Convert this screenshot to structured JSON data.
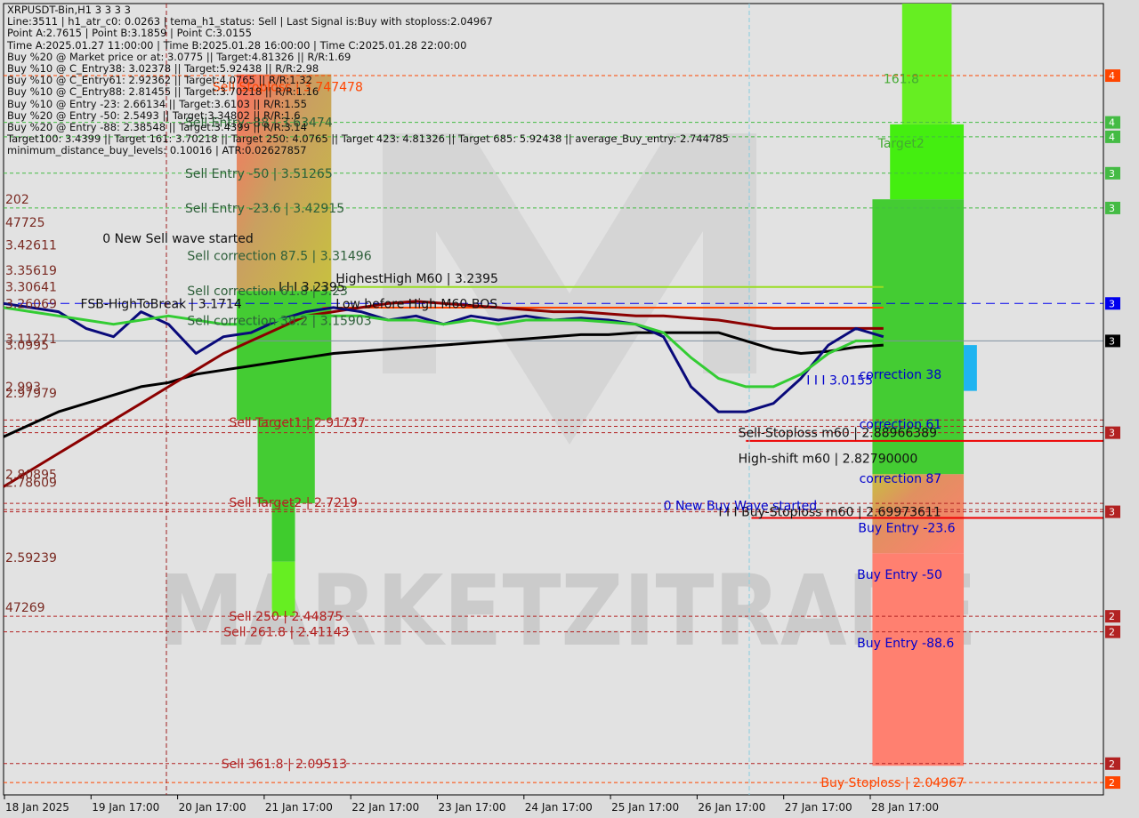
{
  "header": {
    "symbol": "XRPUSDT-Bin,H1  3 3 3 3",
    "lines": [
      "Line:3511 | h1_atr_c0: 0.0263 | tema_h1_status: Sell | Last Signal is:Buy with stoploss:2.04967",
      "Point A:2.7615 | Point B:3.1859 | Point C:3.0155",
      "Time A:2025.01.27 11:00:00 | Time B:2025.01.28 16:00:00 | Time C:2025.01.28 22:00:00",
      "Buy %20 @ Market price or at: 3.0775 || Target:4.81326 || R/R:1.69",
      "Buy %10 @ C_Entry38: 3.02378 || Target:5.92438 || R/R:2.98",
      "Buy %10 @ C_Entry61: 2.92362 || Target:4.0765 || R/R:1.32",
      "Buy %10 @ C_Entry88: 2.81455 || Target:3.70218 || R/R:1.16",
      "Buy %10 @ Entry -23: 2.66134 || Target:3.6103 || R/R:1.55",
      "Buy %20 @ Entry -50: 2.5493 || Target:3.34802 || R/R:1.6",
      "Buy %20 @ Entry -88: 2.38548 || Target:3.4399 || R/R:3.14",
      "Target100: 3.4399 || Target 161: 3.70218 || Target 250: 4.0765 || Target 423: 4.81326 || Target 685: 5.92438 || average_Buy_entry: 2.744785",
      "minimum_distance_buy_levels: 0.10016 | ATR:0.02627857"
    ]
  },
  "watermark": "MARKETZITRADE",
  "colors": {
    "sell_line": "#b22222",
    "buy_line": "#2db82d",
    "stoploss": "#ff4500",
    "ema_black": "#000000",
    "ema_maroon": "#8b0000",
    "tema_navy": "#0a0a7a",
    "green_line": "#33cc33",
    "zone_green": "#44cc33",
    "zone_lime": "#66ee22",
    "zone_red": "#ff8070",
    "zone_olive": "#c8c040",
    "cloud_blue": "#1eb4f0",
    "cloud_orange": "#ff4500"
  },
  "chart_data": {
    "type": "line",
    "title": "XRPUSDT-Bin,H1",
    "xlabel": "",
    "ylabel": "",
    "x_ticks": [
      "18 Jan 2025",
      "19 Jan 17:00",
      "20 Jan 17:00",
      "21 Jan 17:00",
      "22 Jan 17:00",
      "23 Jan 17:00",
      "24 Jan 17:00",
      "25 Jan 17:00",
      "26 Jan 17:00",
      "27 Jan 17:00",
      "28 Jan 17:00"
    ],
    "ylim": [
      2.02,
      3.92
    ],
    "price_badges": [
      {
        "text": "4",
        "price": 3.747,
        "color": "#ff4500"
      },
      {
        "text": "4",
        "price": 3.63474,
        "color": "#44bb44"
      },
      {
        "text": "4",
        "price": 3.6,
        "color": "#44bb44"
      },
      {
        "text": "3",
        "price": 3.51265,
        "color": "#44bb44"
      },
      {
        "text": "3",
        "price": 3.42915,
        "color": "#44bb44"
      },
      {
        "text": "3",
        "price": 3.2,
        "color": "#0000ee"
      },
      {
        "text": "3",
        "price": 3.11,
        "color": "#000000"
      },
      {
        "text": "3",
        "price": 2.88966,
        "color": "#b22222"
      },
      {
        "text": "3",
        "price": 2.69973,
        "color": "#b22222"
      },
      {
        "text": "2",
        "price": 2.44875,
        "color": "#b22222"
      },
      {
        "text": "2",
        "price": 2.41143,
        "color": "#b22222"
      },
      {
        "text": "2",
        "price": 2.09513,
        "color": "#b22222"
      },
      {
        "text": "2",
        "price": 2.04967,
        "color": "#ff4500"
      }
    ],
    "level_labels": [
      {
        "text": "Sell Stoploss | 3.747478",
        "price": 3.72,
        "color": "#ff4500",
        "x": 0.19
      },
      {
        "text": "Sell Entry -88 | 3.63474",
        "price": 3.63474,
        "color": "#2e5f3a",
        "x": 0.165
      },
      {
        "text": "Sell Entry -50 | 3.51265",
        "price": 3.51265,
        "color": "#2e5f3a",
        "x": 0.165
      },
      {
        "text": "Sell Entry -23.6 | 3.42915",
        "price": 3.42915,
        "color": "#2e5f3a",
        "x": 0.165
      },
      {
        "text": "Sell correction 87.5 | 3.31496",
        "price": 3.31496,
        "color": "#2e5f3a",
        "x": 0.167
      },
      {
        "text": "Sell correction 61.8 | 3.23",
        "price": 3.23,
        "color": "#2e5f3a",
        "x": 0.167
      },
      {
        "text": "Sell correction 38.2 | 3.15903",
        "price": 3.15903,
        "color": "#2e5f3a",
        "x": 0.167
      },
      {
        "text": "HighestHigh   M60 | 3.2395",
        "price": 3.26,
        "color": "#111111",
        "x": 0.302
      },
      {
        "text": "Low before High   M60-BOS",
        "price": 3.2,
        "color": "#111111",
        "x": 0.302
      },
      {
        "text": "I I I 3.2395",
        "price": 3.24,
        "color": "#111111",
        "x": 0.25
      },
      {
        "text": "0 New Sell wave started",
        "price": 3.35619,
        "color": "#111111",
        "x": 0.09
      },
      {
        "text": "FSB-HighToBreak | 3.1714",
        "price": 3.2,
        "color": "#111111",
        "x": 0.07
      },
      {
        "text": "Sell Target1 | 2.91737",
        "price": 2.915,
        "color": "#b22222",
        "x": 0.205
      },
      {
        "text": "Sell Target2 | 2.7219",
        "price": 2.7219,
        "color": "#b22222",
        "x": 0.205
      },
      {
        "text": "Sell  250 | 2.44875",
        "price": 2.44875,
        "color": "#b22222",
        "x": 0.205
      },
      {
        "text": "Sell  261.8 | 2.41143",
        "price": 2.41143,
        "color": "#b22222",
        "x": 0.2
      },
      {
        "text": "Sell  361.8 | 2.09513",
        "price": 2.09513,
        "color": "#b22222",
        "x": 0.198
      },
      {
        "text": "I I I 3.0155",
        "price": 3.0155,
        "color": "#0000cc",
        "x": 0.73
      },
      {
        "text": "correction 38",
        "price": 3.03,
        "color": "#0000cc",
        "x": 0.778
      },
      {
        "text": "correction 61",
        "price": 2.91,
        "color": "#0000cc",
        "x": 0.778
      },
      {
        "text": "correction 87",
        "price": 2.78,
        "color": "#0000cc",
        "x": 0.778
      },
      {
        "text": "Sell-Stoploss m60 | 2.88966389",
        "price": 2.89,
        "color": "#111111",
        "x": 0.668
      },
      {
        "text": "High-shift m60 | 2.82790000",
        "price": 2.8279,
        "color": "#111111",
        "x": 0.668
      },
      {
        "text": "I I I Buy-Stoploss m60 | 2.69973611",
        "price": 2.7,
        "color": "#111111",
        "x": 0.65
      },
      {
        "text": "0 New Buy Wave started",
        "price": 2.715,
        "color": "#0000cc",
        "x": 0.6
      },
      {
        "text": "161.8",
        "price": 3.74,
        "color": "#44aa33",
        "x": 0.8
      },
      {
        "text": "Target2",
        "price": 3.585,
        "color": "#44aa33",
        "x": 0.795
      },
      {
        "text": "Buy Entry -23.6",
        "price": 2.66134,
        "color": "#0000cc",
        "x": 0.777
      },
      {
        "text": "Buy Entry -50",
        "price": 2.5493,
        "color": "#0000cc",
        "x": 0.776
      },
      {
        "text": "Buy Entry -88.6",
        "price": 2.38548,
        "color": "#0000cc",
        "x": 0.776
      },
      {
        "text": "Buy Stoploss | 2.04967",
        "price": 2.04967,
        "color": "#ff4500",
        "x": 0.743
      }
    ],
    "left_edge_labels": [
      {
        "text": "202",
        "price": 3.45
      },
      {
        "text": "47725",
        "price": 3.395
      },
      {
        "text": "3.42611",
        "price": 3.34
      },
      {
        "text": "3.35619",
        "price": 3.28
      },
      {
        "text": "3.30641",
        "price": 3.24
      },
      {
        "text": "3.26069",
        "price": 3.2
      },
      {
        "text": "3.11271",
        "price": 3.115
      },
      {
        "text": "3.0995",
        "price": 3.1
      },
      {
        "text": "2.993",
        "price": 3.0
      },
      {
        "text": "2.97979",
        "price": 2.985
      },
      {
        "text": "2.80895",
        "price": 2.79
      },
      {
        "text": "2.78609",
        "price": 2.77
      },
      {
        "text": "2.59239",
        "price": 2.59
      },
      {
        "text": "47269",
        "price": 2.47
      }
    ],
    "series": [
      {
        "name": "EMA black",
        "color": "#000000",
        "values": [
          2.88,
          2.91,
          2.94,
          2.96,
          2.98,
          3.0,
          3.01,
          3.03,
          3.04,
          3.05,
          3.06,
          3.07,
          3.08,
          3.085,
          3.09,
          3.095,
          3.1,
          3.105,
          3.11,
          3.115,
          3.12,
          3.125,
          3.125,
          3.13,
          3.13,
          3.13,
          3.13,
          3.11,
          3.09,
          3.08,
          3.085,
          3.095,
          3.1
        ]
      },
      {
        "name": "EMA maroon",
        "color": "#8b0000",
        "values": [
          2.76,
          2.8,
          2.84,
          2.88,
          2.92,
          2.96,
          3.0,
          3.04,
          3.08,
          3.11,
          3.14,
          3.17,
          3.18,
          3.19,
          3.2,
          3.205,
          3.2,
          3.195,
          3.19,
          3.185,
          3.18,
          3.18,
          3.175,
          3.17,
          3.17,
          3.165,
          3.16,
          3.15,
          3.14,
          3.14,
          3.14,
          3.14,
          3.14
        ]
      },
      {
        "name": "TEMA navy",
        "color": "#0a0a7a",
        "values": [
          3.2,
          3.19,
          3.18,
          3.14,
          3.12,
          3.18,
          3.15,
          3.08,
          3.12,
          3.13,
          3.16,
          3.18,
          3.19,
          3.18,
          3.16,
          3.17,
          3.15,
          3.17,
          3.16,
          3.17,
          3.16,
          3.165,
          3.16,
          3.15,
          3.12,
          3.0,
          2.94,
          2.94,
          2.96,
          3.02,
          3.1,
          3.14,
          3.12
        ]
      },
      {
        "name": "Signal green",
        "color": "#33cc33",
        "values": [
          3.19,
          3.18,
          3.17,
          3.16,
          3.15,
          3.16,
          3.17,
          3.16,
          3.15,
          3.15,
          3.16,
          3.17,
          3.17,
          3.17,
          3.16,
          3.16,
          3.15,
          3.16,
          3.15,
          3.16,
          3.16,
          3.16,
          3.155,
          3.15,
          3.13,
          3.07,
          3.02,
          3.0,
          3.0,
          3.03,
          3.08,
          3.11,
          3.11
        ]
      }
    ]
  }
}
